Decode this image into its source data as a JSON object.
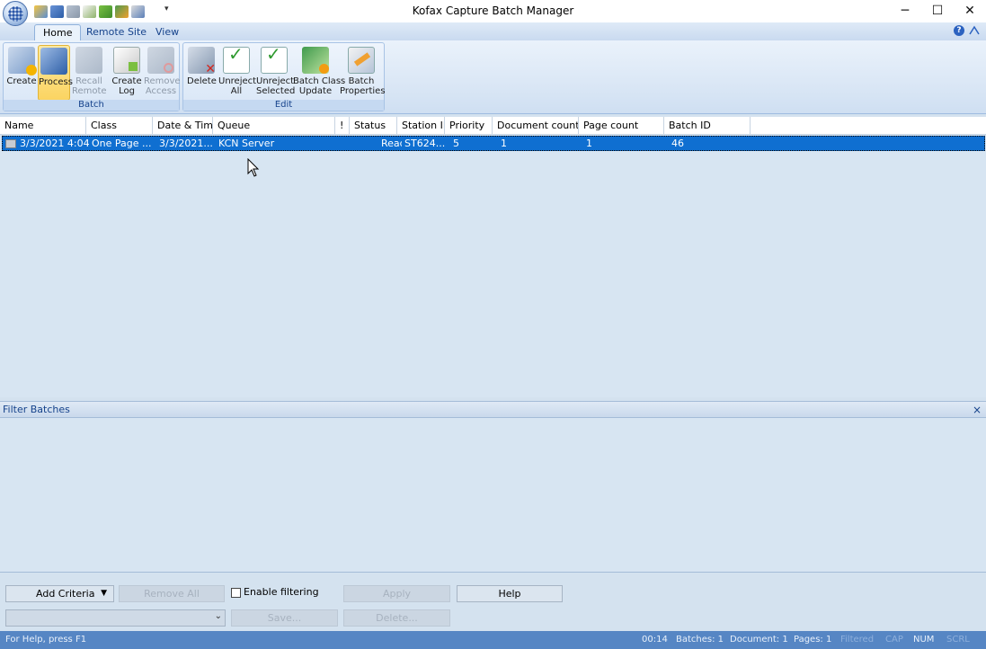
{
  "window": {
    "title": "Kofax Capture Batch Manager",
    "controls": {
      "minimize": "─",
      "maximize": "☐",
      "close": "✕"
    }
  },
  "quick_access": {
    "dropdown": "▾"
  },
  "ribbon": {
    "tabs": [
      {
        "label": "Home",
        "active": true
      },
      {
        "label": "Remote Site",
        "active": false
      },
      {
        "label": "View",
        "active": false
      }
    ],
    "help_icon": "?",
    "groups": {
      "batch": {
        "label": "Batch",
        "buttons": [
          {
            "line1": "Create",
            "line2": "",
            "icon": "create-batch-icon",
            "enabled": true
          },
          {
            "line1": "Process",
            "line2": "",
            "icon": "process-batch-icon",
            "enabled": true,
            "active": true
          },
          {
            "line1": "Recall",
            "line2": "Remote",
            "icon": "recall-remote-icon",
            "enabled": false
          },
          {
            "line1": "Create",
            "line2": "Log",
            "icon": "create-log-icon",
            "enabled": true
          },
          {
            "line1": "Remove",
            "line2": "Access",
            "icon": "remove-access-icon",
            "enabled": false
          }
        ]
      },
      "edit": {
        "label": "Edit",
        "buttons": [
          {
            "line1": "Delete",
            "line2": "",
            "icon": "delete-icon",
            "enabled": true
          },
          {
            "line1": "Unreject",
            "line2": "All",
            "icon": "unreject-all-icon",
            "enabled": true
          },
          {
            "line1": "Unreject",
            "line2": "Selected",
            "icon": "unreject-selected-icon",
            "enabled": true
          },
          {
            "line1": "Batch Class",
            "line2": "Update",
            "icon": "batch-class-update-icon",
            "enabled": true
          },
          {
            "line1": "Batch",
            "line2": "Properties",
            "icon": "batch-properties-icon",
            "enabled": true
          }
        ]
      }
    }
  },
  "grid": {
    "columns": [
      "Name",
      "Class",
      "Date & Time",
      "Queue",
      "!",
      "Status",
      "Station ID",
      "Priority",
      "Document count",
      "Page count",
      "Batch ID"
    ],
    "rows": [
      {
        "name": "3/3/2021 4:04...",
        "class": "One Page ...",
        "date_time": "3/3/2021...",
        "queue": "KCN Server",
        "flag": "",
        "status": "Ready",
        "station_id": "ST624...",
        "priority": "5",
        "document_count": "1",
        "page_count": "1",
        "batch_id": "46"
      }
    ]
  },
  "filter_pane": {
    "title": "Filter Batches",
    "close": "×",
    "add_criteria": "Add Criteria",
    "remove_all": "Remove All",
    "enable_filtering": "Enable filtering",
    "enable_filtering_checked": false,
    "apply": "Apply",
    "help": "Help",
    "saved_filter_value": "",
    "save": "Save...",
    "delete": "Delete..."
  },
  "statusbar": {
    "help_text": "For Help, press F1",
    "time": "00:14",
    "batches": "Batches: 1",
    "document": "Document: 1",
    "pages": "Pages: 1",
    "filtered": "Filtered",
    "cap": "CAP",
    "num": "NUM",
    "scrl": "SCRL"
  },
  "colors": {
    "selection": "#0f6fd1",
    "ribbon_text": "#15428b",
    "statusbar": "#5686c4",
    "active_button": "#fbd461"
  }
}
